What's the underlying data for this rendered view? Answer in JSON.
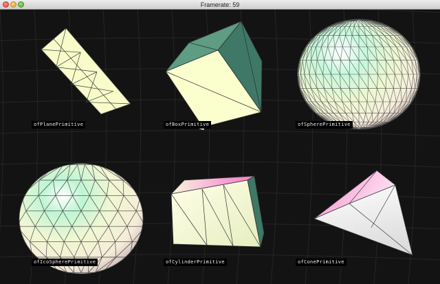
{
  "window": {
    "title": "Framerate: 59"
  },
  "primitives": [
    {
      "label": "ofPlanePrimitive"
    },
    {
      "label": "ofBoxPrimitive"
    },
    {
      "label": "ofSpherePrimitive"
    },
    {
      "label": "ofIcoSpherePrimitive"
    },
    {
      "label": "ofCylinderPrimitive"
    },
    {
      "label": "ofConePrimitive"
    }
  ],
  "colors": {
    "background": "#131313",
    "grid": "#2a2a2a",
    "face_light": "#f7fcc8",
    "face_dark": "#4f8a74",
    "highlight_pink": "#f28ccd",
    "highlight_mint": "#9ff0cc",
    "wire": "#3a3a3a"
  }
}
